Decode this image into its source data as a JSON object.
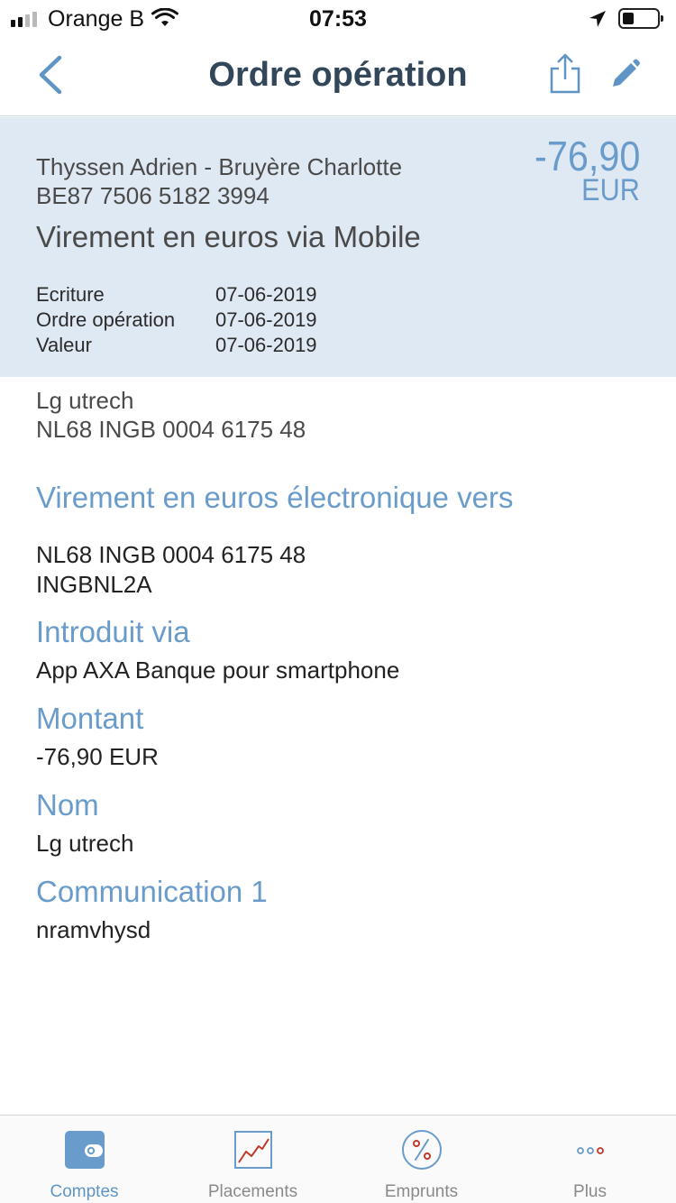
{
  "status_bar": {
    "carrier": "Orange B",
    "time": "07:53"
  },
  "nav": {
    "title": "Ordre opération"
  },
  "summary": {
    "holder": "Thyssen Adrien - Bruyère Charlotte",
    "iban": "BE87 7506 5182 3994",
    "amount": "-76,90",
    "currency": "EUR",
    "operation": "Virement en euros via Mobile",
    "dates": [
      {
        "label": "Ecriture",
        "value": "07-06-2019"
      },
      {
        "label": "Ordre opération",
        "value": "07-06-2019"
      },
      {
        "label": "Valeur",
        "value": "07-06-2019"
      }
    ]
  },
  "counterparty": {
    "name": "Lg utrech",
    "iban": "NL68 INGB 0004 6175 48"
  },
  "details": {
    "transfer_heading": "Virement en euros électronique vers",
    "transfer_iban": "NL68 INGB 0004 6175 48",
    "transfer_bic": "INGBNL2A",
    "via_heading": "Introduit via",
    "via_value": "App AXA Banque pour smartphone",
    "amount_heading": "Montant",
    "amount_value": "-76,90 EUR",
    "name_heading": "Nom",
    "name_value": "Lg utrech",
    "comm_heading": "Communication 1",
    "comm_value": "nramvhysd"
  },
  "tabs": [
    {
      "label": "Comptes",
      "icon": "wallet-icon",
      "active": true
    },
    {
      "label": "Placements",
      "icon": "chart-icon",
      "active": false
    },
    {
      "label": "Emprunts",
      "icon": "percent-icon",
      "active": false
    },
    {
      "label": "Plus",
      "icon": "more-dots-icon",
      "active": false
    }
  ],
  "colors": {
    "accent": "#6a9ccb",
    "summary_bg": "#dfe9f3",
    "title": "#33475b",
    "chart_line": "#c0392b"
  }
}
